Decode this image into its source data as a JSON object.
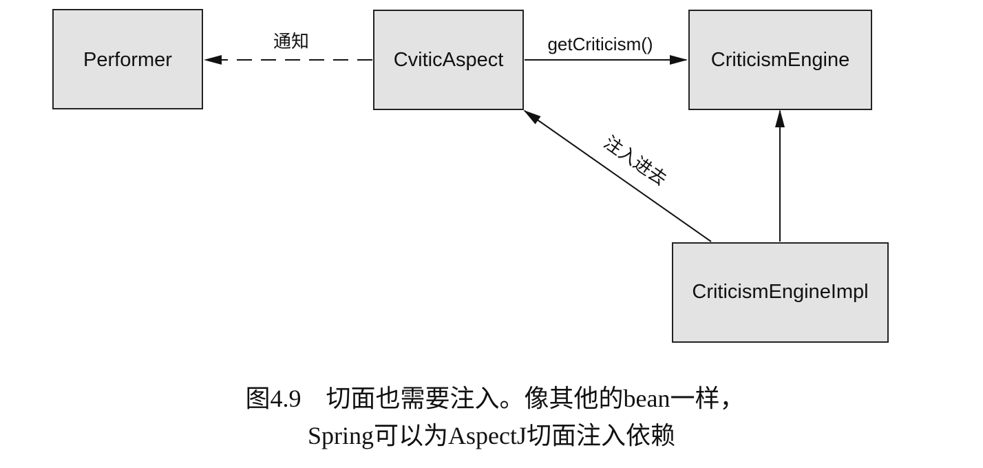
{
  "nodes": {
    "performer": "Performer",
    "cvitic_aspect": "CviticAspect",
    "criticism_engine": "CriticismEngine",
    "criticism_engine_impl": "CriticismEngineImpl"
  },
  "edges": {
    "notify_label": "通知",
    "get_criticism_label": "getCriticism()",
    "inject_label": "注入进去"
  },
  "caption": {
    "line1": "图4.9　切面也需要注入。像其他的bean一样，",
    "line2": "Spring可以为AspectJ切面注入依赖"
  },
  "colors": {
    "box_fill": "#e3e3e3",
    "box_stroke": "#222222",
    "line": "#111111"
  }
}
